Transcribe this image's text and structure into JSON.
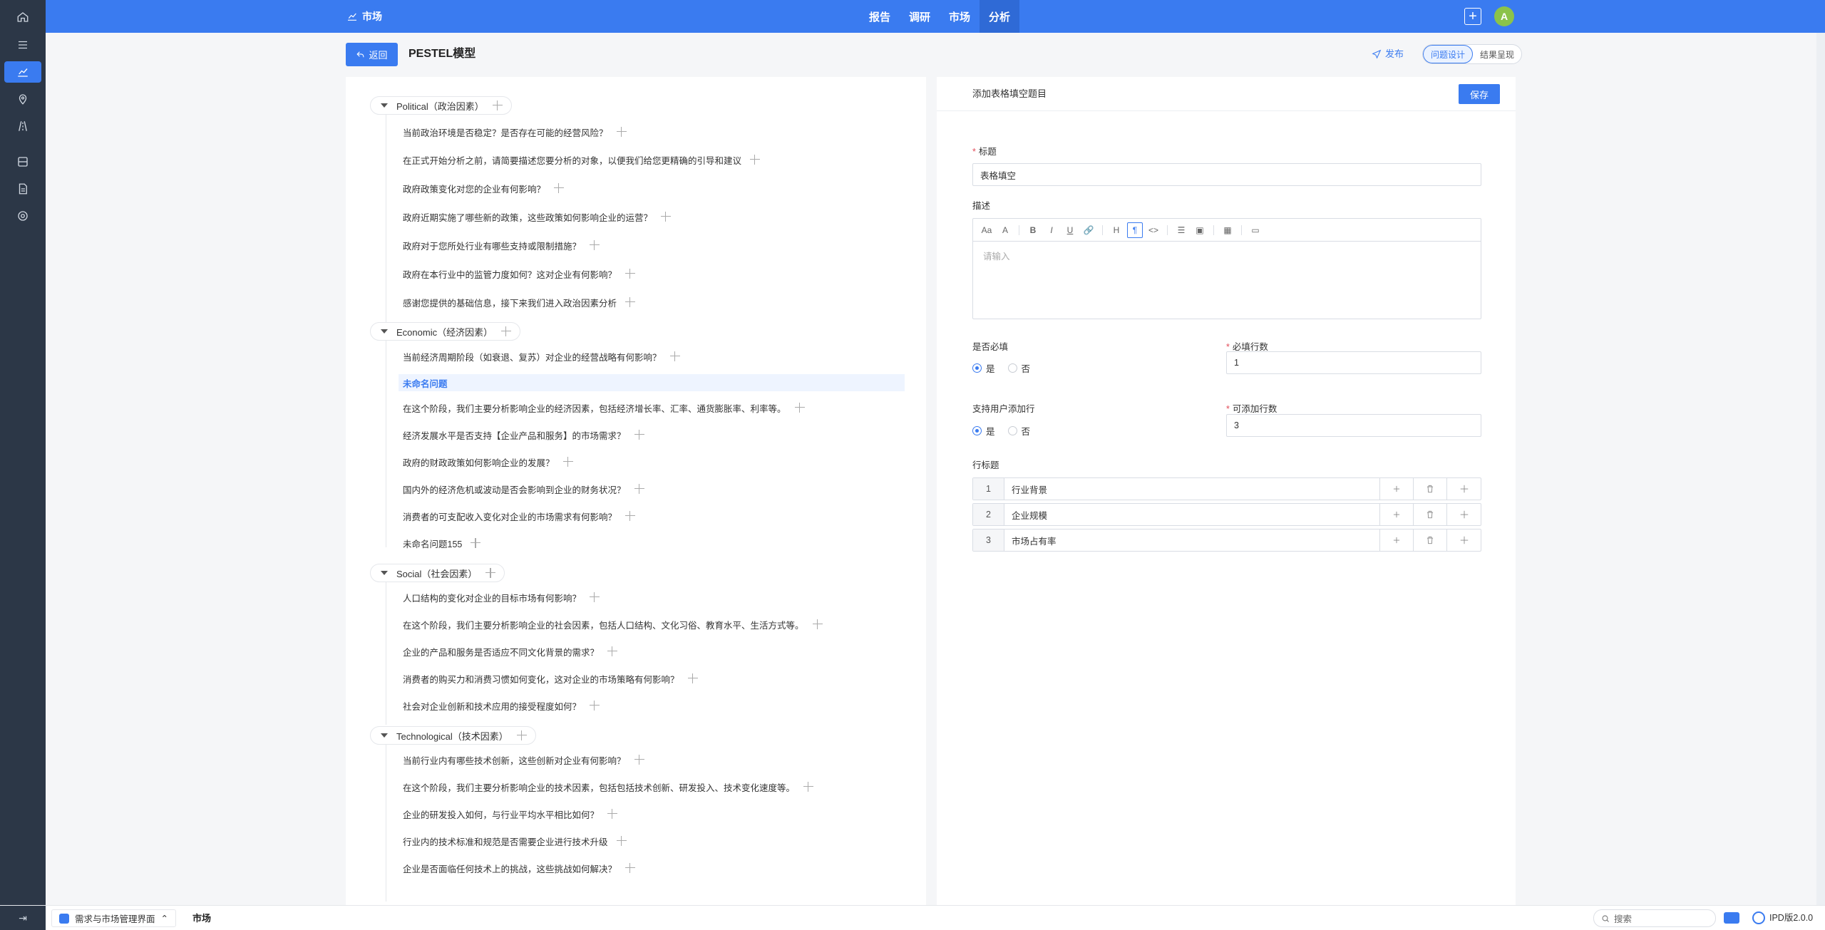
{
  "topbar": {
    "brand": "市场",
    "nav": [
      "报告",
      "调研",
      "市场",
      "分析"
    ],
    "active_nav": 3,
    "avatar": "A",
    "plus": "+"
  },
  "header": {
    "back_label": "返回",
    "title": "PESTEL模型",
    "publish_label": "发布",
    "seg_design": "问题设计",
    "seg_result": "结果呈现"
  },
  "tree": {
    "groups": [
      {
        "label": "Political（政治因素）",
        "items": [
          "当前政治环境是否稳定？是否存在可能的经营风险？",
          "在正式开始分析之前，请简要描述您要分析的对象，以便我们给您更精确的引导和建议",
          "政府政策变化对您的企业有何影响？",
          "政府近期实施了哪些新的政策，这些政策如何影响企业的运营？",
          "政府对于您所处行业有哪些支持或限制措施？",
          "政府在本行业中的监管力度如何？这对企业有何影响？",
          "感谢您提供的基础信息，接下来我们进入政治因素分析"
        ]
      },
      {
        "label": "Economic（经济因素）",
        "items": [
          "当前经济周期阶段（如衰退、复苏）对企业的经营战略有何影响？",
          "未命名问题",
          "在这个阶段，我们主要分析影响企业的经济因素，包括经济增长率、汇率、通货膨胀率、利率等。",
          "经济发展水平是否支持【企业产品和服务】的市场需求？",
          "政府的财政政策如何影响企业的发展？",
          "国内外的经济危机或波动是否会影响到企业的财务状况？",
          "消费者的可支配收入变化对企业的市场需求有何影响？",
          "未命名问题155"
        ]
      },
      {
        "label": "Social（社会因素）",
        "items": [
          "人口结构的变化对企业的目标市场有何影响？",
          "在这个阶段，我们主要分析影响企业的社会因素，包括人口结构、文化习俗、教育水平、生活方式等。",
          "企业的产品和服务是否适应不同文化背景的需求？",
          "消费者的购买力和消费习惯如何变化，这对企业的市场策略有何影响？",
          "社会对企业创新和技术应用的接受程度如何？"
        ]
      },
      {
        "label": "Technological（技术因素）",
        "items": [
          "当前行业内有哪些技术创新，这些创新对企业有何影响？",
          "在这个阶段，我们主要分析影响企业的技术因素，包括包括技术创新、研发投入、技术变化速度等。",
          "企业的研发投入如何，与行业平均水平相比如何？",
          "行业内的技术标准和规范是否需要企业进行技术升级",
          "企业是否面临任何技术上的挑战，这些挑战如何解决？"
        ]
      }
    ]
  },
  "form": {
    "panel_title": "添加表格填空题目",
    "save_label": "保存",
    "title_label": "标题",
    "title_value": "表格填空",
    "desc_label": "描述",
    "desc_placeholder": "请输入",
    "required_label": "是否必填",
    "yes": "是",
    "no": "否",
    "required_rows_label": "必填行数",
    "required_rows_value": "1",
    "allow_add_label": "支持用户添加行",
    "addable_rows_label": "可添加行数",
    "addable_rows_value": "3",
    "row_title_label": "行标题",
    "rows": [
      {
        "idx": "1",
        "text": "行业背景"
      },
      {
        "idx": "2",
        "text": "企业规模"
      },
      {
        "idx": "3",
        "text": "市场占有率"
      }
    ],
    "toolbar": [
      "Aa",
      "A",
      "B",
      "I",
      "U",
      "link",
      "H",
      "¶",
      "<>",
      "list",
      "image",
      "table",
      "block"
    ]
  },
  "bottombar": {
    "app_label": "需求与市场管理界面",
    "tab_label": "市场",
    "search_placeholder": "搜索",
    "version": "IPD版2.0.0"
  },
  "colors": {
    "primary": "#3a7bf0",
    "rail": "#2c3747",
    "required_mark": "#e34d59"
  }
}
